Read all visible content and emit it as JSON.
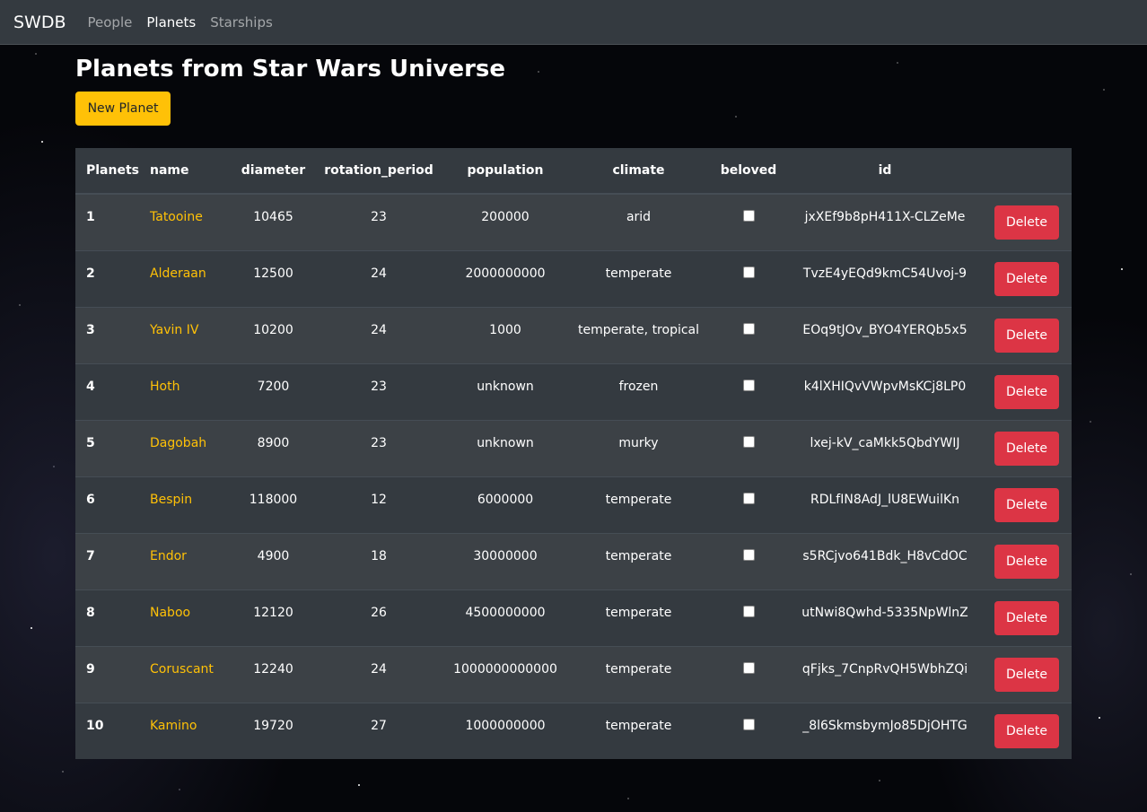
{
  "navbar": {
    "brand": "SWDB",
    "links": [
      {
        "label": "People",
        "active": false
      },
      {
        "label": "Planets",
        "active": true
      },
      {
        "label": "Starships",
        "active": false
      }
    ]
  },
  "page": {
    "title": "Planets from Star Wars Universe",
    "new_button": "New Planet"
  },
  "table": {
    "headers": [
      "Planets",
      "name",
      "diameter",
      "rotation_period",
      "population",
      "climate",
      "beloved",
      "id"
    ],
    "delete_label": "Delete",
    "rows": [
      {
        "n": "1",
        "name": "Tatooine",
        "diameter": "10465",
        "rotation_period": "23",
        "population": "200000",
        "climate": "arid",
        "beloved": false,
        "id": "jxXEf9b8pH411X-CLZeMe"
      },
      {
        "n": "2",
        "name": "Alderaan",
        "diameter": "12500",
        "rotation_period": "24",
        "population": "2000000000",
        "climate": "temperate",
        "beloved": false,
        "id": "TvzE4yEQd9kmC54Uvoj-9"
      },
      {
        "n": "3",
        "name": "Yavin IV",
        "diameter": "10200",
        "rotation_period": "24",
        "population": "1000",
        "climate": "temperate, tropical",
        "beloved": false,
        "id": "EOq9tJOv_BYO4YERQb5x5"
      },
      {
        "n": "4",
        "name": "Hoth",
        "diameter": "7200",
        "rotation_period": "23",
        "population": "unknown",
        "climate": "frozen",
        "beloved": false,
        "id": "k4lXHIQvVWpvMsKCj8LP0"
      },
      {
        "n": "5",
        "name": "Dagobah",
        "diameter": "8900",
        "rotation_period": "23",
        "population": "unknown",
        "climate": "murky",
        "beloved": false,
        "id": "lxej-kV_caMkk5QbdYWIJ"
      },
      {
        "n": "6",
        "name": "Bespin",
        "diameter": "118000",
        "rotation_period": "12",
        "population": "6000000",
        "climate": "temperate",
        "beloved": false,
        "id": "RDLfIN8AdJ_lU8EWuilKn"
      },
      {
        "n": "7",
        "name": "Endor",
        "diameter": "4900",
        "rotation_period": "18",
        "population": "30000000",
        "climate": "temperate",
        "beloved": false,
        "id": "s5RCjvo641Bdk_H8vCdOC"
      },
      {
        "n": "8",
        "name": "Naboo",
        "diameter": "12120",
        "rotation_period": "26",
        "population": "4500000000",
        "climate": "temperate",
        "beloved": false,
        "id": "utNwi8Qwhd-5335NpWlnZ"
      },
      {
        "n": "9",
        "name": "Coruscant",
        "diameter": "12240",
        "rotation_period": "24",
        "population": "1000000000000",
        "climate": "temperate",
        "beloved": false,
        "id": "qFjks_7CnpRvQH5WbhZQi"
      },
      {
        "n": "10",
        "name": "Kamino",
        "diameter": "19720",
        "rotation_period": "27",
        "population": "1000000000",
        "climate": "temperate",
        "beloved": false,
        "id": "_8l6SkmsbymJo85DjOHTG"
      }
    ]
  },
  "colors": {
    "navbar_bg": "#343a40",
    "accent": "#ffc107",
    "danger": "#dc3545"
  }
}
